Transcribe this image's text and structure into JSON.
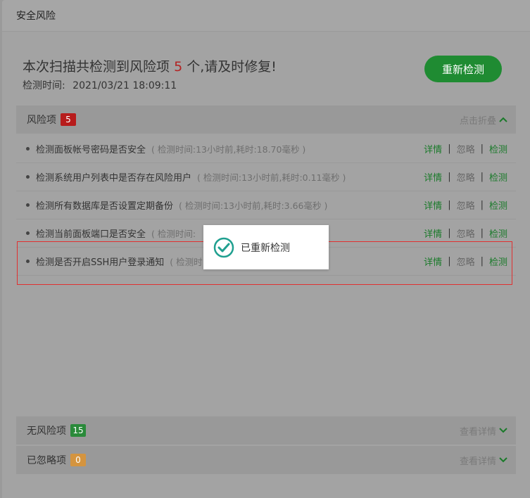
{
  "modal": {
    "title": "安全风险"
  },
  "summary": {
    "prefix": "本次扫描共检测到风险项",
    "count": "5",
    "suffix": "个,请及时修复!",
    "time_label": "检测时间:",
    "time_value": "2021/03/21 18:09:11"
  },
  "rescan_button": "重新检测",
  "risk_section": {
    "label": "风险项",
    "count": "5",
    "toggle": "点击折叠"
  },
  "risks": [
    {
      "title": "检测面板帐号密码是否安全",
      "meta": "( 检测时间:13小时前,耗时:18.70毫秒 )"
    },
    {
      "title": "检测系统用户列表中是否存在风险用户",
      "meta": "( 检测时间:13小时前,耗时:0.11毫秒 )"
    },
    {
      "title": "检测所有数据库是否设置定期备份",
      "meta": "( 检测时间:13小时前,耗时:3.66毫秒 )"
    },
    {
      "title": "检测当前面板端口是否安全",
      "meta": "( 检测时间:"
    },
    {
      "title": "检测是否开启SSH用户登录通知",
      "meta": "( 检测时"
    }
  ],
  "actions": {
    "detail": "详情",
    "ignore": "忽略",
    "check": "检测",
    "sep": "|"
  },
  "safe_section": {
    "label": "无风险项",
    "count": "15",
    "toggle": "查看详情"
  },
  "ignored_section": {
    "label": "已忽略项",
    "count": "0",
    "toggle": "查看详情"
  },
  "toast": {
    "message": "已重新检测"
  },
  "colors": {
    "accent": "#1f8b32",
    "danger": "#b71c1c",
    "warning": "#d4943f"
  }
}
